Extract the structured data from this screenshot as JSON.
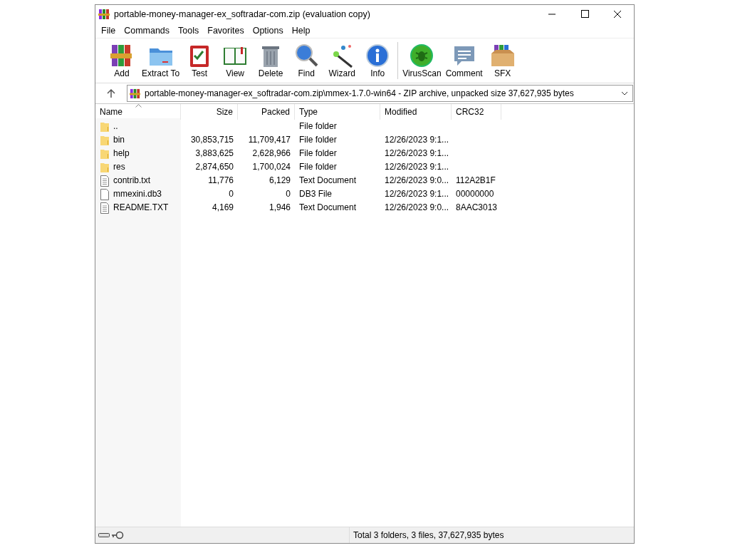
{
  "window": {
    "title": "portable-money-manager-ex_softradar-com.zip (evaluation copy)"
  },
  "menu": [
    "File",
    "Commands",
    "Tools",
    "Favorites",
    "Options",
    "Help"
  ],
  "toolbar": [
    {
      "label": "Add",
      "kind": "add"
    },
    {
      "label": "Extract To",
      "kind": "extract"
    },
    {
      "label": "Test",
      "kind": "test"
    },
    {
      "label": "View",
      "kind": "view"
    },
    {
      "label": "Delete",
      "kind": "delete"
    },
    {
      "label": "Find",
      "kind": "find"
    },
    {
      "label": "Wizard",
      "kind": "wizard"
    },
    {
      "label": "Info",
      "kind": "info"
    },
    {
      "label": "VirusScan",
      "kind": "virus"
    },
    {
      "label": "Comment",
      "kind": "comment"
    },
    {
      "label": "SFX",
      "kind": "sfx"
    }
  ],
  "address": {
    "value": "portable-money-manager-ex_softradar-com.zip\\mmex-1.7.0-win64 - ZIP archive, unpacked size 37,627,935 bytes"
  },
  "table": {
    "columns": [
      "Name",
      "Size",
      "Packed",
      "Type",
      "Modified",
      "CRC32"
    ],
    "rows": [
      {
        "kind": "folder",
        "cells": [
          "..",
          "",
          "",
          "File folder",
          "",
          ""
        ]
      },
      {
        "kind": "folder",
        "cells": [
          "bin",
          "30,853,715",
          "11,709,417",
          "File folder",
          "12/26/2023 9:1...",
          ""
        ]
      },
      {
        "kind": "folder",
        "cells": [
          "help",
          "3,883,625",
          "2,628,966",
          "File folder",
          "12/26/2023 9:1...",
          ""
        ]
      },
      {
        "kind": "folder",
        "cells": [
          "res",
          "2,874,650",
          "1,700,024",
          "File folder",
          "12/26/2023 9:1...",
          ""
        ]
      },
      {
        "kind": "text",
        "cells": [
          "contrib.txt",
          "11,776",
          "6,129",
          "Text Document",
          "12/26/2023 9:0...",
          "112A2B1F"
        ]
      },
      {
        "kind": "blank",
        "cells": [
          "mmexini.db3",
          "0",
          "0",
          "DB3 File",
          "12/26/2023 9:1...",
          "00000000"
        ]
      },
      {
        "kind": "text",
        "cells": [
          "README.TXT",
          "4,169",
          "1,946",
          "Text Document",
          "12/26/2023 9:0...",
          "8AAC3013"
        ]
      }
    ]
  },
  "status_bar": {
    "text": "Total 3 folders, 3 files, 37,627,935 bytes"
  }
}
